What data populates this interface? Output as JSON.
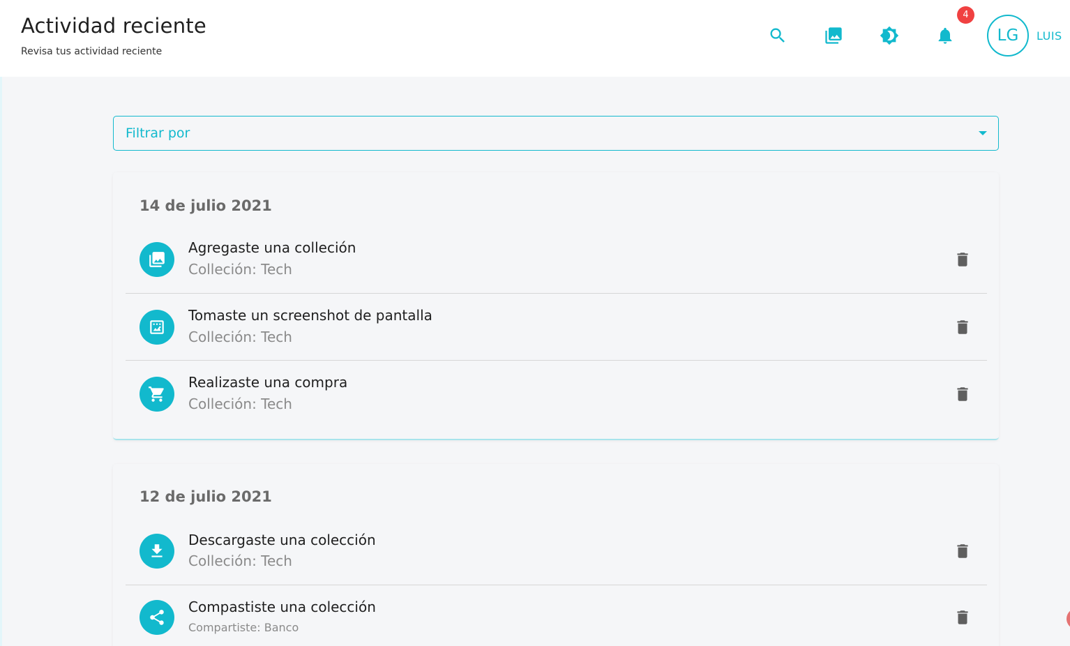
{
  "header": {
    "title": "Actividad reciente",
    "subtitle": "Revisa tus actividad reciente",
    "notification_count": "4",
    "avatar_initials": "LG",
    "username": "LUIS",
    "icons": [
      "search-icon",
      "collections-icon",
      "brightness-icon",
      "bell-icon"
    ]
  },
  "filter": {
    "label": "Filtrar por"
  },
  "groups": [
    {
      "date": "14 de julio 2021",
      "items": [
        {
          "icon": "collections-icon",
          "title": "Agregaste una colleción",
          "subtitle": "Colleción: Tech"
        },
        {
          "icon": "screenshot-icon",
          "title": "Tomaste un screenshot de pantalla",
          "subtitle": "Colleción: Tech"
        },
        {
          "icon": "cart-icon",
          "title": "Realizaste una compra",
          "subtitle": "Colleción: Tech"
        }
      ]
    },
    {
      "date": "12 de julio 2021",
      "items": [
        {
          "icon": "download-icon",
          "title": "Descargaste una colección",
          "subtitle": "Colleción: Tech"
        },
        {
          "icon": "share-icon",
          "title": "Compastiste una colección",
          "subtitle": "Compartiste: Banco"
        }
      ]
    }
  ],
  "colors": {
    "accent": "#12b9cd",
    "badge": "#f04141",
    "trash": "#5f5f5f"
  }
}
